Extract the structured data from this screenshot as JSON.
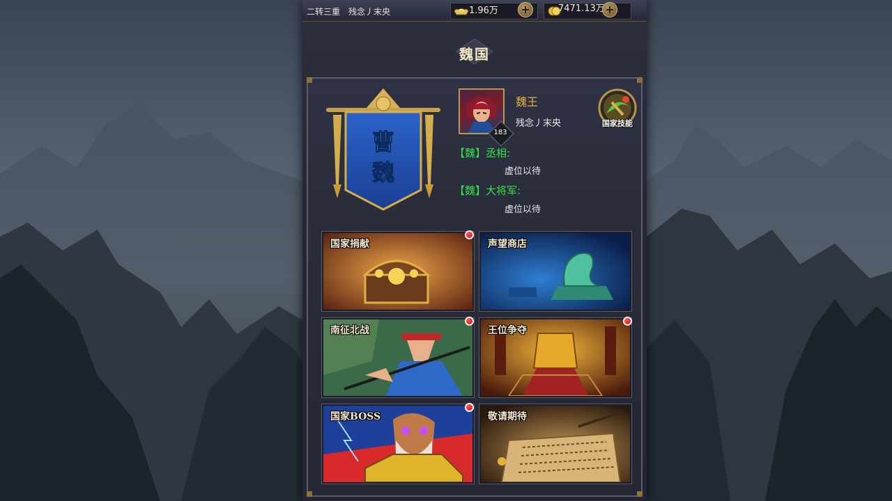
{
  "topbar": {
    "rank": "二转三重",
    "player_name": "残念丿末央",
    "silver": "1.96万",
    "gold": "7471.13万"
  },
  "page": {
    "title": "魏国"
  },
  "banner": {
    "text_top": "曹",
    "text_bottom": "魏"
  },
  "king": {
    "title": "魏王",
    "name": "残念丿末央",
    "level": "183"
  },
  "skill_button": {
    "label": "国家技能"
  },
  "roles": [
    {
      "title": "【魏】丞相:",
      "value": "虚位以待"
    },
    {
      "title": "【魏】大将军:",
      "value": "虚位以待"
    }
  ],
  "cards": [
    {
      "label": "国家捐献",
      "red_dot": true
    },
    {
      "label": "声望商店",
      "red_dot": false
    },
    {
      "label": "南征北战",
      "red_dot": true
    },
    {
      "label": "王位争夺",
      "red_dot": true
    },
    {
      "label": "国家BOSS",
      "red_dot": true
    },
    {
      "label": "敬请期待",
      "red_dot": false
    }
  ],
  "colors": {
    "accent_gold": "#e3b33a",
    "role_green": "#35e24a",
    "notify_red": "#d40000"
  }
}
